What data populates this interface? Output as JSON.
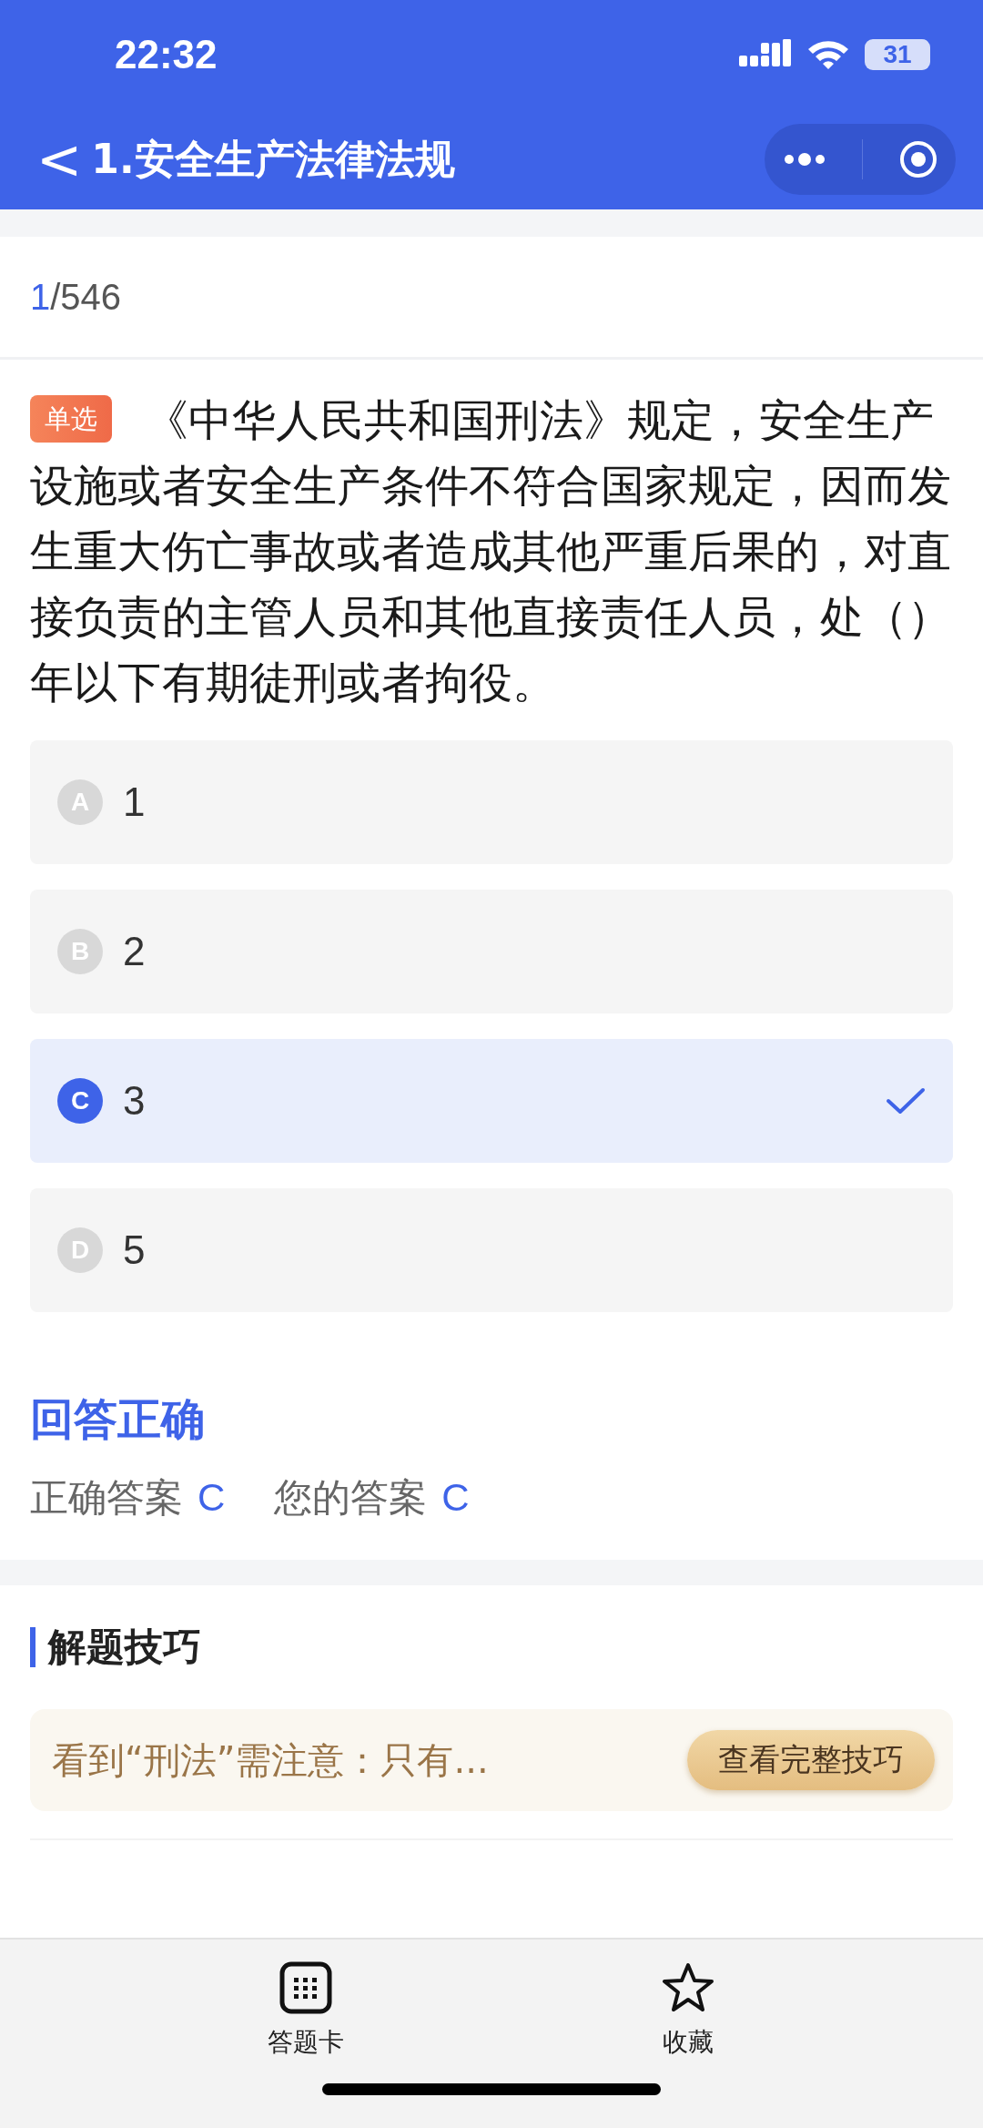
{
  "status_bar": {
    "time": "22:32",
    "battery": "31"
  },
  "nav": {
    "back": "<",
    "title": "1.安全生产法律法规"
  },
  "counter": {
    "current": "1",
    "total": "/546"
  },
  "question": {
    "type_tag": "单选",
    "text": "《中华人民共和国刑法》规定，安全生产设施或者安全生产条件不符合国家规定，因而发生重大伤亡事故或者造成其他严重后果的，对直接负责的主管人员和其他直接责任人员，处（）年以下有期徒刑或者拘役。"
  },
  "options": [
    {
      "letter": "A",
      "text": "1",
      "selected": false
    },
    {
      "letter": "B",
      "text": "2",
      "selected": false
    },
    {
      "letter": "C",
      "text": "3",
      "selected": true
    },
    {
      "letter": "D",
      "text": "5",
      "selected": false
    }
  ],
  "result": {
    "status": "回答正确",
    "correct_label": "正确答案",
    "correct_value": "C",
    "yours_label": "您的答案",
    "yours_value": "C"
  },
  "tips": {
    "heading": "解题技巧",
    "preview": "看到“刑法”需注意：只有...",
    "button": "查看完整技巧"
  },
  "bottom_bar": [
    {
      "kind": "grid",
      "label": "答题卡"
    },
    {
      "kind": "star",
      "label": "收藏"
    }
  ]
}
